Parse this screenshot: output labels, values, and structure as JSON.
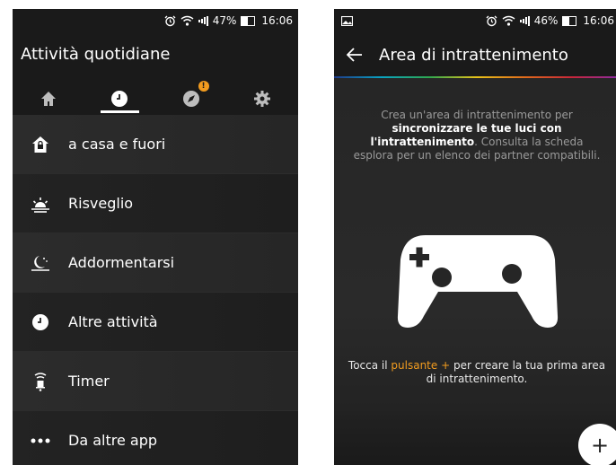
{
  "left": {
    "status": {
      "battery": "47%",
      "time": "16:06",
      "battery_level": 0.47
    },
    "title": "Attività quotidiane",
    "tabs": [
      {
        "icon": "home-icon"
      },
      {
        "icon": "clock-icon",
        "active": true
      },
      {
        "icon": "explore-icon",
        "badge": "!"
      },
      {
        "icon": "gear-icon"
      }
    ],
    "items": [
      {
        "label": "a casa e fuori",
        "icon": "home-lock-icon"
      },
      {
        "label": "Risveglio",
        "icon": "sunrise-icon"
      },
      {
        "label": "Addormentarsi",
        "icon": "moon-icon"
      },
      {
        "label": "Altre attività",
        "icon": "clock-icon"
      },
      {
        "label": "Timer",
        "icon": "timer-icon"
      },
      {
        "label": "Da altre app",
        "icon": "more-icon"
      }
    ]
  },
  "right": {
    "status": {
      "battery": "46%",
      "time": "16:06",
      "battery_level": 0.46
    },
    "title": "Area di intrattenimento",
    "intro": {
      "pre": "Crea un'area di intrattenimento per ",
      "bold": "sincronizzare le tue luci con l'intrattenimento",
      "post": ". Consulta la scheda esplora per un elenco dei partner compatibili."
    },
    "hint": {
      "pre": "Tocca il ",
      "accent": "pulsante +",
      "post": " per creare la tua prima area di intrattenimento."
    },
    "fab_label": "+",
    "colors": {
      "accent": "#f29c1f"
    }
  }
}
